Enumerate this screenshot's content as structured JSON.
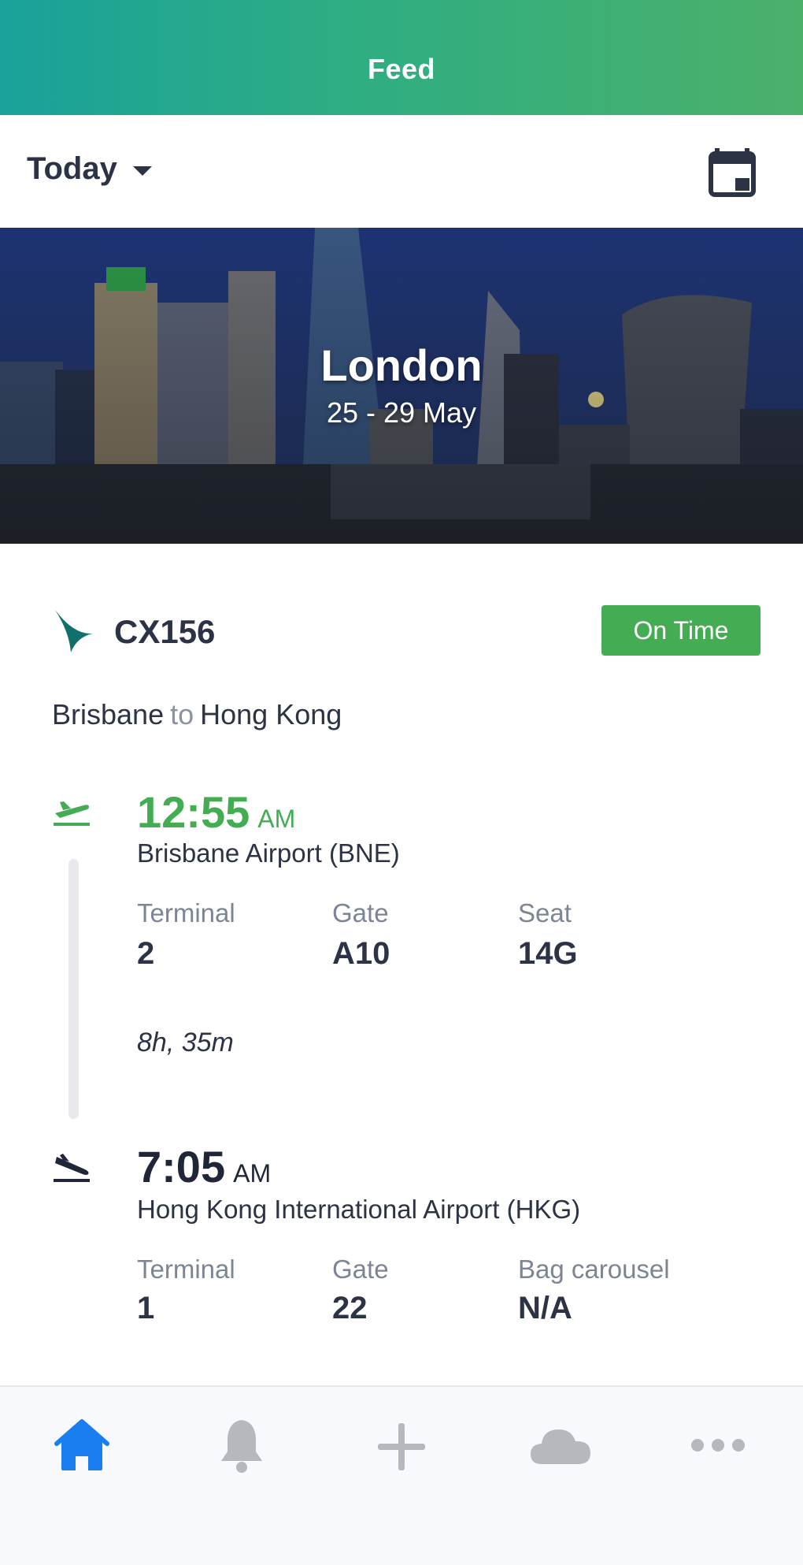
{
  "header": {
    "title": "Feed"
  },
  "toolbar": {
    "date_filter": "Today",
    "calendar_icon": "calendar-icon"
  },
  "hero": {
    "city": "London",
    "dates": "25 - 29 May"
  },
  "flight": {
    "airline_icon": "airline-logo-icon",
    "number": "CX156",
    "status": "On Time",
    "status_color": "#44ad54",
    "route": {
      "from": "Brisbane",
      "connector": "to",
      "to": "Hong Kong"
    },
    "departure": {
      "icon": "takeoff-icon",
      "time": "12:55",
      "ampm": "AM",
      "airport": "Brisbane Airport (BNE)",
      "terminal_label": "Terminal",
      "terminal": "2",
      "gate_label": "Gate",
      "gate": "A10",
      "seat_label": "Seat",
      "seat": "14G"
    },
    "duration": "8h, 35m",
    "arrival": {
      "icon": "landing-icon",
      "time": "7:05",
      "ampm": "AM",
      "airport": "Hong Kong International Airport (HKG)",
      "terminal_label": "Terminal",
      "terminal": "1",
      "gate_label": "Gate",
      "gate": "22",
      "bag_label": "Bag carousel",
      "bag": "N/A"
    }
  },
  "tabbar": {
    "active_color": "#1a7ef0",
    "inactive_color": "#b5b8bd",
    "items": [
      {
        "icon": "home-icon",
        "active": true
      },
      {
        "icon": "bell-icon",
        "active": false
      },
      {
        "icon": "plus-icon",
        "active": false
      },
      {
        "icon": "cloud-icon",
        "active": false
      },
      {
        "icon": "more-icon",
        "active": false
      }
    ]
  }
}
